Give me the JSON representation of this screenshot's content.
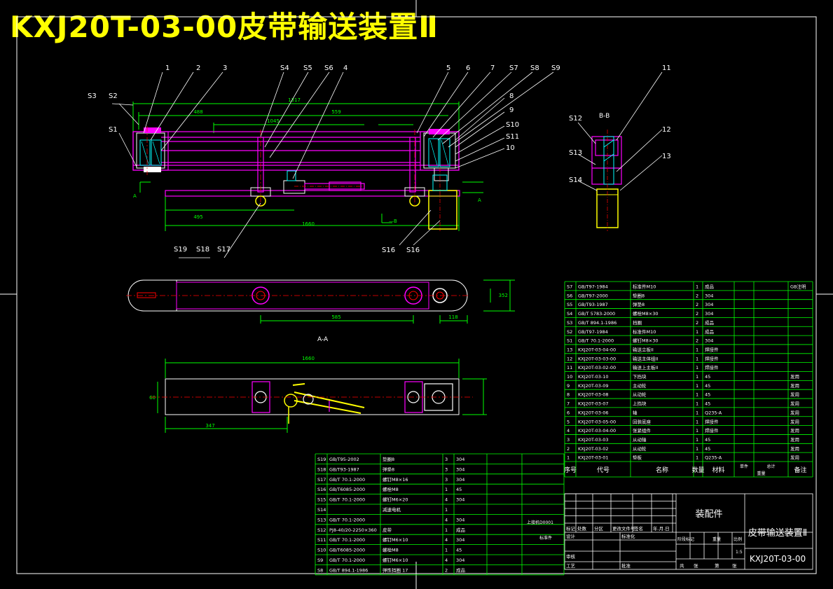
{
  "title": "KXJ20T-03-00皮带输送装置Ⅱ",
  "colors": {
    "background": "#000000",
    "title": "#ffff00",
    "frame": "#ffffff",
    "part": "#ff00ff",
    "dimension": "#00ff00",
    "leader": "#ffffff",
    "table": "#00ff00",
    "center": "#ff0000",
    "hatch": "#00ffff",
    "motor": "#ffff00"
  },
  "front_view": {
    "balloons_top": [
      "1",
      "2",
      "3",
      "S4",
      "S5",
      "S6",
      "4",
      "5",
      "6",
      "7",
      "S7",
      "S8",
      "S9"
    ],
    "balloons_left": [
      "S3",
      "S2",
      "S1"
    ],
    "balloons_right": [
      "8",
      "9",
      "S10",
      "S11",
      "10"
    ],
    "balloons_bottom": [
      "S19",
      "S18",
      "S17",
      "S16",
      "S16"
    ],
    "dims": [
      "1317",
      "488",
      "1045",
      "559",
      "495",
      "1660",
      "A",
      "A"
    ]
  },
  "section_view": {
    "label": "B-B",
    "balloons": [
      "S12",
      "S13",
      "S14",
      "11",
      "12",
      "13"
    ]
  },
  "top_view": {
    "dims": [
      "585",
      "118",
      "352"
    ]
  },
  "view_aa": {
    "label": "A-A",
    "dims": [
      "1660",
      "347",
      "60"
    ]
  },
  "bom_right": {
    "rows": [
      [
        "S7",
        "GB/T97-1984",
        "标准件M10",
        "1",
        "成品",
        "",
        "",
        "GB注明"
      ],
      [
        "S6",
        "GB/T97-2000",
        "垫圈8",
        "2",
        "304",
        "",
        "",
        ""
      ],
      [
        "S5",
        "GB/T93-1987",
        "弹垫8",
        "2",
        "304",
        "",
        "",
        ""
      ],
      [
        "S4",
        "GB/T 5783-2000",
        "螺栓M8×30",
        "2",
        "304",
        "",
        "",
        ""
      ],
      [
        "S3",
        "GB/T 894.1-1986",
        "挡圈",
        "2",
        "成品",
        "",
        "",
        ""
      ],
      [
        "S2",
        "GB/T97-1984",
        "标准件M10",
        "1",
        "成品",
        "",
        "",
        ""
      ],
      [
        "S1",
        "GB/T 70.1-2000",
        "螺钉M8×30",
        "2",
        "304",
        "",
        "",
        ""
      ],
      [
        "13",
        "KXJ20T-03-04-00",
        "输送立板II",
        "1",
        "焊接件",
        "",
        "",
        ""
      ],
      [
        "12",
        "KXJ20T-03-03-00",
        "输送主体组II",
        "1",
        "焊接件",
        "",
        "",
        ""
      ],
      [
        "11",
        "KXJ20T-03-02-00",
        "输送上主板II",
        "1",
        "焊接件",
        "",
        "",
        ""
      ],
      [
        "10",
        "KXJ20T-03-10",
        "下挡块",
        "1",
        "45",
        "",
        "",
        "发用"
      ],
      [
        "9",
        "KXJ20T-03-09",
        "主动轮",
        "1",
        "45",
        "",
        "",
        "发用"
      ],
      [
        "8",
        "KXJ20T-03-08",
        "从动轮",
        "1",
        "45",
        "",
        "",
        "发用"
      ],
      [
        "7",
        "KXJ20T-03-07",
        "上挡块",
        "1",
        "45",
        "",
        "",
        "发用"
      ],
      [
        "6",
        "KXJ20T-03-06",
        "轴",
        "1",
        "Q235-A",
        "",
        "",
        "发用"
      ],
      [
        "5",
        "KXJ20T-03-05-00",
        "回装底座",
        "1",
        "焊接件",
        "",
        "",
        "发用"
      ],
      [
        "4",
        "KXJ20T-03-04-00",
        "张紧组件",
        "1",
        "焊接件",
        "",
        "",
        "发用"
      ],
      [
        "3",
        "KXJ20T-03-03",
        "从动轴",
        "1",
        "45",
        "",
        "",
        "发用"
      ],
      [
        "2",
        "KXJ20T-03-02",
        "从动轮",
        "1",
        "45",
        "",
        "",
        "发用"
      ],
      [
        "1",
        "KXJ20T-03-01",
        "垫板",
        "1",
        "Q235-A",
        "",
        "",
        "发用"
      ]
    ],
    "header": [
      "序号",
      "代号",
      "名称",
      "数量",
      "材料",
      "单件",
      "总计",
      "备注"
    ],
    "header_sub": "重量"
  },
  "bom_left": {
    "rows": [
      [
        "S19",
        "GB/T95-2002",
        "垫圈8",
        "3",
        "304"
      ],
      [
        "S18",
        "GB/T93-1987",
        "弹垫8",
        "3",
        "304"
      ],
      [
        "S17",
        "GB/T 70.1-2000",
        "螺钉M8×16",
        "3",
        "304"
      ],
      [
        "S16",
        "GB/T6085-2000",
        "螺栓M8",
        "1",
        "45"
      ],
      [
        "S15",
        "GB/T 70.1-2000",
        "螺钉M6×20",
        "4",
        "304"
      ],
      [
        "S14",
        "",
        "减速电机",
        "1",
        ""
      ],
      [
        "S13",
        "GB/T 70.1-2000",
        "",
        "4",
        "304"
      ],
      [
        "S12",
        "PJ8-40/20-2250×360",
        "皮带",
        "1",
        "成品"
      ],
      [
        "S11",
        "GB/T 70.1-2000",
        "螺钉M6×10",
        "4",
        "304"
      ],
      [
        "S10",
        "GB/T6085-2000",
        "螺栓M8",
        "1",
        "45"
      ],
      [
        "S9",
        "GB/T 70.1-2000",
        "螺钉M6×10",
        "4",
        "304"
      ],
      [
        "S8",
        "GB/T 894.1-1986",
        "弹性挡圈 17",
        "2",
        "成品"
      ]
    ]
  },
  "title_block": {
    "assembly": "装配件",
    "name": "皮带输送装置Ⅱ",
    "code": "KXJ20T-03-00",
    "scale": "1:5",
    "signature_row": [
      "标记",
      "处数",
      "分区",
      "更改文件号",
      "签名",
      "年.月.日"
    ],
    "roles": [
      "设计",
      "标准化",
      "审核",
      "工艺",
      "批准"
    ],
    "stage_labels": [
      "阶段标记",
      "重量",
      "比例"
    ],
    "sheet": [
      "共",
      "张",
      "第",
      "张"
    ],
    "note1": "上接机D0001",
    "note2": "标准件"
  }
}
